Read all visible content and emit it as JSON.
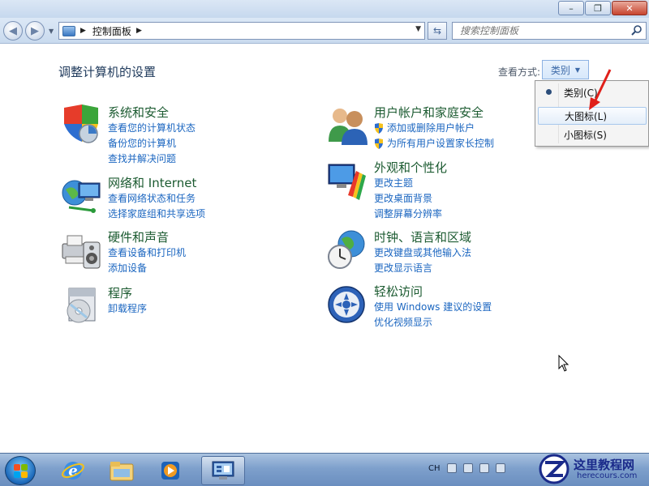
{
  "window": {
    "controls": {
      "minimize": "–",
      "restore": "❐",
      "close": "✕"
    }
  },
  "navbar": {
    "breadcrumb": "控制面板",
    "search_placeholder": "搜索控制面板"
  },
  "header": {
    "title": "调整计算机的设置",
    "view_by_label": "查看方式:",
    "view_by_value": "类别"
  },
  "view_menu": {
    "items": [
      {
        "label": "类别(C)",
        "selected": true
      },
      {
        "label": "大图标(L)",
        "selected": false
      },
      {
        "label": "小图标(S)",
        "selected": false
      }
    ]
  },
  "categories": [
    {
      "title": "系统和安全",
      "icon": "system-security-icon",
      "links": [
        "查看您的计算机状态",
        "备份您的计算机",
        "查找并解决问题"
      ]
    },
    {
      "title": "网络和 Internet",
      "icon": "network-icon",
      "links": [
        "查看网络状态和任务",
        "选择家庭组和共享选项"
      ]
    },
    {
      "title": "硬件和声音",
      "icon": "hardware-sound-icon",
      "links": [
        "查看设备和打印机",
        "添加设备"
      ]
    },
    {
      "title": "程序",
      "icon": "programs-icon",
      "links": [
        "卸载程序"
      ]
    },
    {
      "title": "用户帐户和家庭安全",
      "icon": "user-accounts-icon",
      "links": [
        "添加或删除用户帐户",
        "为所有用户设置家长控制"
      ]
    },
    {
      "title": "外观和个性化",
      "icon": "appearance-icon",
      "links": [
        "更改主题",
        "更改桌面背景",
        "调整屏幕分辨率"
      ]
    },
    {
      "title": "时钟、语言和区域",
      "icon": "clock-language-icon",
      "links": [
        "更改键盘或其他输入法",
        "更改显示语言"
      ]
    },
    {
      "title": "轻松访问",
      "icon": "ease-of-access-icon",
      "links": [
        "使用 Windows 建议的设置",
        "优化视频显示"
      ]
    }
  ],
  "taskbar": {
    "tray_language": "CH",
    "pinned": [
      "ie-icon",
      "explorer-icon",
      "media-player-icon",
      "control-panel-icon"
    ]
  },
  "watermark": {
    "text": "这里教程网",
    "domain": "herecours.com"
  },
  "colors": {
    "category_title": "#1c5b31",
    "link": "#1b66c0",
    "heading": "#1e395b",
    "taskbar": "#7ea0cc"
  }
}
